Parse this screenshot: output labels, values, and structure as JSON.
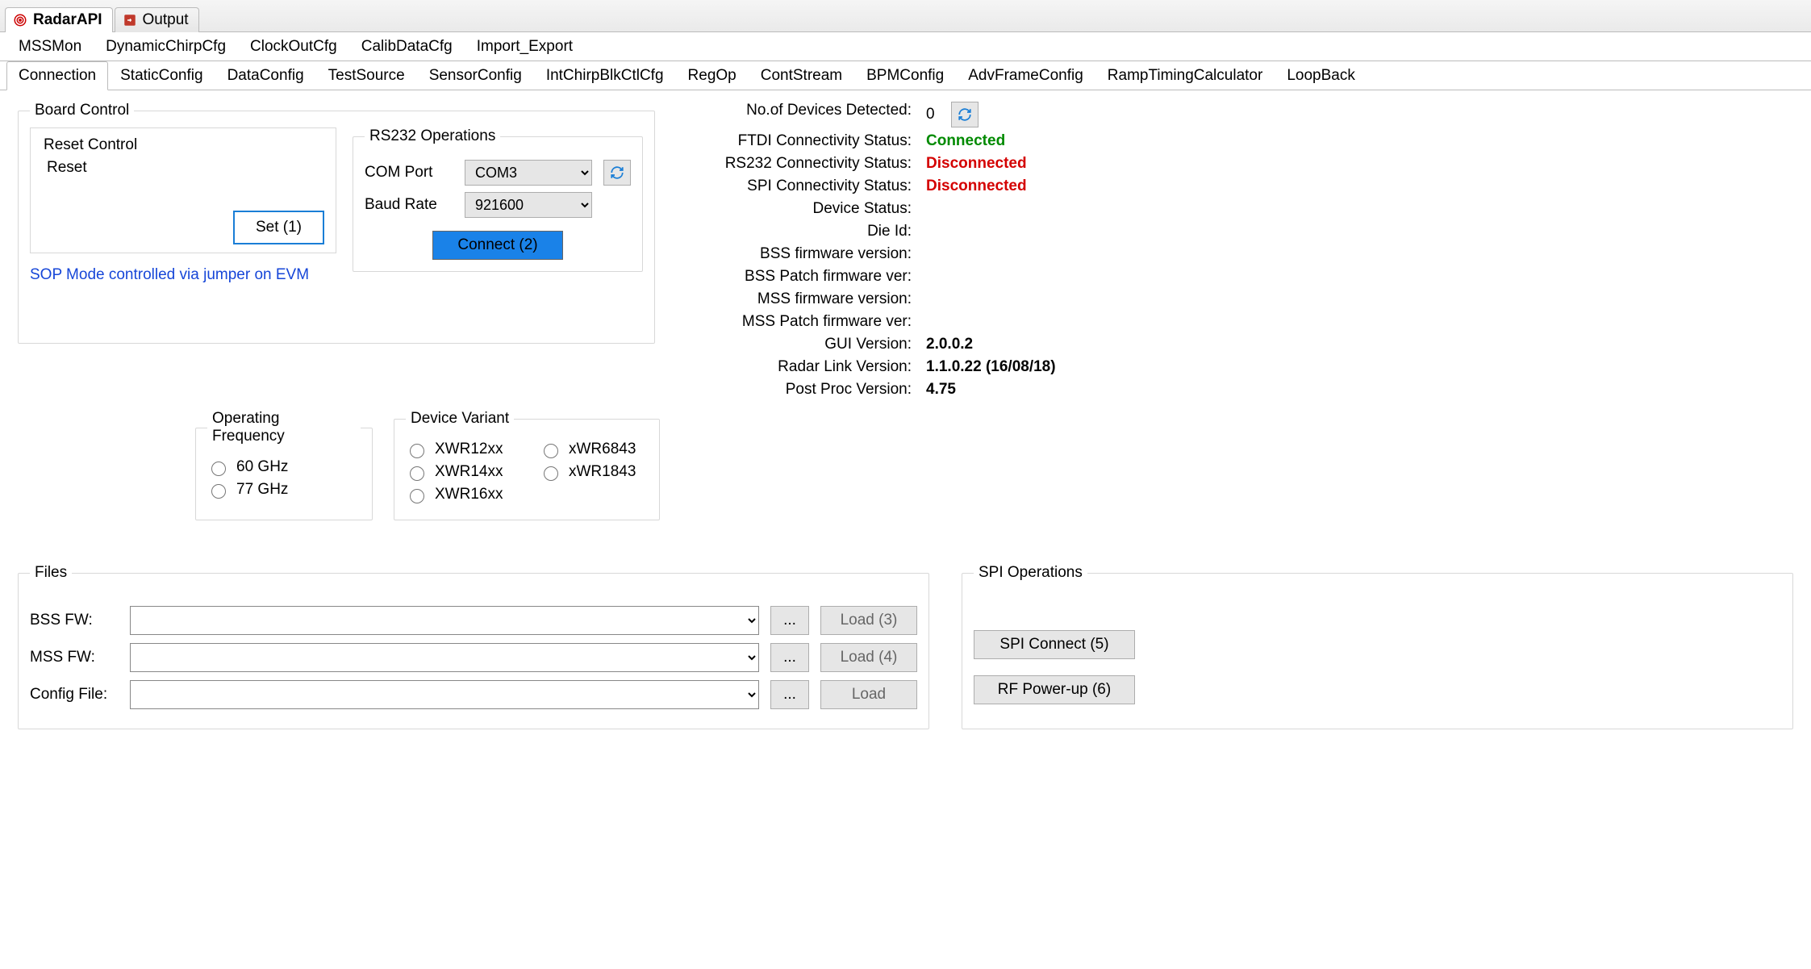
{
  "fileTabs": [
    {
      "label": "RadarAPI",
      "icon": "radar",
      "active": true
    },
    {
      "label": "Output",
      "icon": "out",
      "active": false
    }
  ],
  "tabRow1": [
    "MSSMon",
    "DynamicChirpCfg",
    "ClockOutCfg",
    "CalibDataCfg",
    "Import_Export"
  ],
  "tabRow2": [
    "Connection",
    "StaticConfig",
    "DataConfig",
    "TestSource",
    "SensorConfig",
    "IntChirpBlkCtlCfg",
    "RegOp",
    "ContStream",
    "BPMConfig",
    "AdvFrameConfig",
    "RampTimingCalculator",
    "LoopBack"
  ],
  "tabRow2Active": "Connection",
  "boardControl": {
    "legend": "Board Control",
    "resetLegend": "Reset Control",
    "resetLabel": "Reset",
    "setButton": "Set (1)",
    "sopNote": "SOP Mode controlled via jumper on EVM"
  },
  "rs232": {
    "legend": "RS232 Operations",
    "comPortLabel": "COM Port",
    "comPortValue": "COM3",
    "baudLabel": "Baud Rate",
    "baudValue": "921600",
    "connectButton": "Connect (2)"
  },
  "status": {
    "rows": [
      {
        "k": "No.of Devices Detected:",
        "v": "0",
        "refresh": true
      },
      {
        "k": "FTDI Connectivity Status:",
        "v": "Connected",
        "cls": "green"
      },
      {
        "k": "RS232 Connectivity Status:",
        "v": "Disconnected",
        "cls": "red"
      },
      {
        "k": "SPI Connectivity Status:",
        "v": "Disconnected",
        "cls": "red"
      },
      {
        "k": "Device Status:",
        "v": ""
      },
      {
        "k": "Die Id:",
        "v": ""
      },
      {
        "k": "BSS firmware version:",
        "v": ""
      },
      {
        "k": "BSS Patch firmware ver:",
        "v": ""
      },
      {
        "k": "MSS firmware version:",
        "v": ""
      },
      {
        "k": "MSS Patch firmware ver:",
        "v": ""
      },
      {
        "k": "GUI Version:",
        "v": "2.0.0.2",
        "cls": "bold"
      },
      {
        "k": "Radar Link Version:",
        "v": "1.1.0.22 (16/08/18)",
        "cls": "bold"
      },
      {
        "k": "Post Proc Version:",
        "v": "4.75",
        "cls": "bold"
      }
    ]
  },
  "operatingFrequency": {
    "legend": "Operating Frequency",
    "options": [
      "60 GHz",
      "77 GHz"
    ]
  },
  "deviceVariant": {
    "legend": "Device Variant",
    "col1": [
      "XWR12xx",
      "XWR14xx",
      "XWR16xx"
    ],
    "col2": [
      "xWR6843",
      "xWR1843"
    ]
  },
  "files": {
    "legend": "Files",
    "rows": [
      {
        "label": "BSS FW:",
        "load": "Load (3)"
      },
      {
        "label": "MSS FW:",
        "load": "Load (4)"
      },
      {
        "label": "Config File:",
        "load": "Load"
      }
    ],
    "browse": "..."
  },
  "spiOps": {
    "legend": "SPI Operations",
    "connect": "SPI Connect (5)",
    "powerup": "RF Power-up (6)"
  }
}
